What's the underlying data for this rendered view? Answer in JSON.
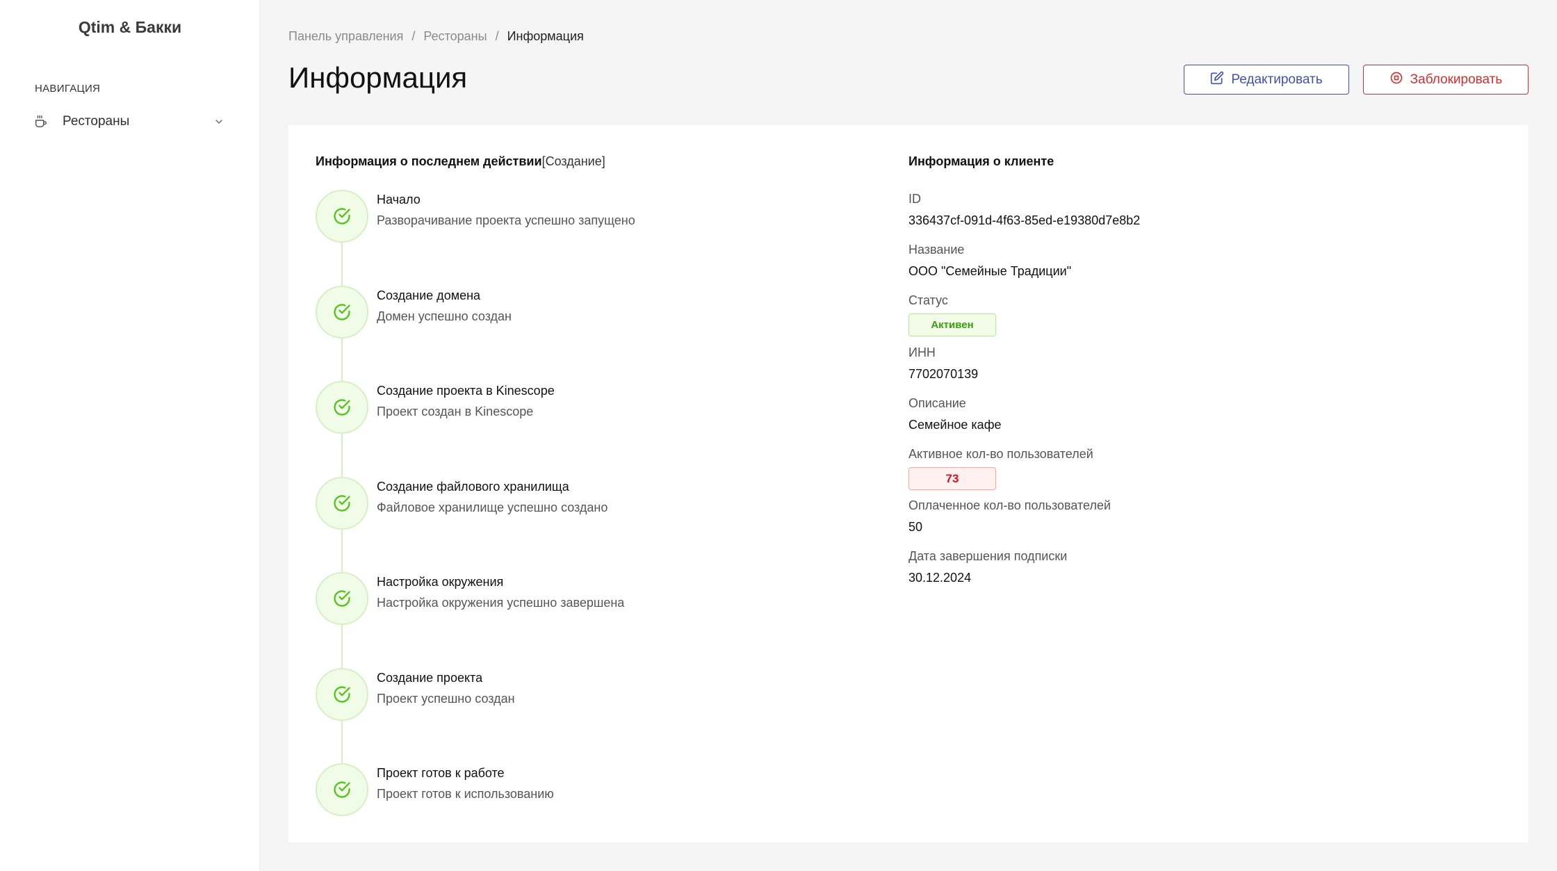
{
  "sidebar": {
    "brand": "Qtim & Бакки",
    "nav_heading": "НАВИГАЦИЯ",
    "items": [
      {
        "label": "Рестораны",
        "icon": "coffee-cup-icon"
      }
    ]
  },
  "breadcrumb": {
    "items": [
      "Панель управления",
      "Рестораны"
    ],
    "current": "Информация",
    "separator": "/"
  },
  "header": {
    "title": "Информация",
    "edit_label": "Редактировать",
    "block_label": "Заблокировать"
  },
  "last_action": {
    "title": "Информация о последнем действии",
    "tag": "[Создание]",
    "steps": [
      {
        "title": "Начало",
        "desc": "Разворачивание проекта успешно запущено"
      },
      {
        "title": "Создание домена",
        "desc": "Домен успешно создан"
      },
      {
        "title": "Создание проекта в Kinescope",
        "desc": "Проект создан в Kinescope"
      },
      {
        "title": "Создание файлового хранилища",
        "desc": "Файловое хранилище успешно создано"
      },
      {
        "title": "Настройка окружения",
        "desc": "Настройка окружения успешно завершена"
      },
      {
        "title": "Создание проекта",
        "desc": "Проект успешно создан"
      },
      {
        "title": "Проект готов к работе",
        "desc": "Проект готов к использованию"
      }
    ]
  },
  "client": {
    "title": "Информация о клиенте",
    "id_label": "ID",
    "id_value": "336437cf-091d-4f63-85ed-e19380d7e8b2",
    "name_label": "Название",
    "name_value": "ООО \"Семейные Традиции\"",
    "status_label": "Статус",
    "status_value": "Активен",
    "inn_label": "ИНН",
    "inn_value": "7702070139",
    "desc_label": "Описание",
    "desc_value": "Семейное кафе",
    "active_users_label": "Активное кол-во пользователей",
    "active_users_value": "73",
    "paid_users_label": "Оплаченное кол-во пользователей",
    "paid_users_value": "50",
    "sub_end_label": "Дата завершения подписки",
    "sub_end_value": "30.12.2024"
  },
  "colors": {
    "primary": "#3f51b5",
    "danger": "#d32f2f",
    "success": "#52c41a"
  }
}
